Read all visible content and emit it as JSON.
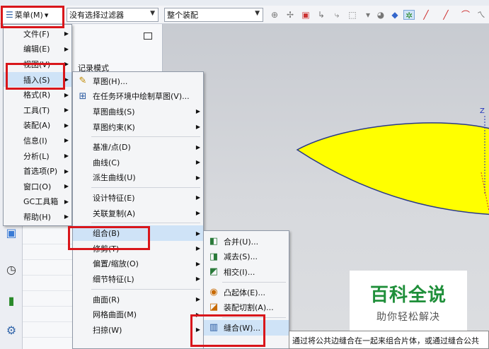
{
  "toolbar": {
    "menu_label": "菜单(M)",
    "menu_arrow": "▾",
    "filter_value": "没有选择过滤器",
    "assembly_value": "整个装配",
    "combo_arrow": "▼"
  },
  "main_menu": {
    "items": [
      {
        "label": "文件(F)"
      },
      {
        "label": "编辑(E)"
      },
      {
        "label": "视图(V)"
      },
      {
        "label": "插入(S)"
      },
      {
        "label": "格式(R)"
      },
      {
        "label": "工具(T)"
      },
      {
        "label": "装配(A)"
      },
      {
        "label": "信息(I)"
      },
      {
        "label": "分析(L)"
      },
      {
        "label": "首选项(P)"
      },
      {
        "label": "窗口(O)"
      },
      {
        "label": "GC工具箱"
      },
      {
        "label": "帮助(H)"
      }
    ]
  },
  "navigator": {
    "partial_label": "记录模式"
  },
  "insert_menu": {
    "items": [
      {
        "label": "草图(H)..."
      },
      {
        "label": "在任务环境中绘制草图(V)..."
      },
      {
        "label": "草图曲线(S)"
      },
      {
        "label": "草图约束(K)"
      },
      {
        "label": "基准/点(D)"
      },
      {
        "label": "曲线(C)"
      },
      {
        "label": "派生曲线(U)"
      },
      {
        "label": "设计特征(E)"
      },
      {
        "label": "关联复制(A)"
      },
      {
        "label": "组合(B)"
      },
      {
        "label": "修剪(T)"
      },
      {
        "label": "偏置/缩放(O)"
      },
      {
        "label": "细节特征(L)"
      },
      {
        "label": "曲面(R)"
      },
      {
        "label": "网格曲面(M)"
      },
      {
        "label": "扫掠(W)"
      }
    ]
  },
  "combine_menu": {
    "items": [
      {
        "label": "合并(U)..."
      },
      {
        "label": "减去(S)..."
      },
      {
        "label": "相交(I)..."
      },
      {
        "label": "凸起体(E)..."
      },
      {
        "label": "装配切割(A)..."
      },
      {
        "label": "缝合(W)..."
      }
    ]
  },
  "tooltip": {
    "text": "通过将公共边缝合在一起来组合片体，或通过缝合公共"
  },
  "watermark": {
    "title": "百科全说",
    "subtitle": "助你轻松解决"
  },
  "viewport": {
    "axis_label": "Z"
  },
  "colors": {
    "highlight": "#d9161b",
    "surface": "#ffff00",
    "watermark_green": "#1f8f3a"
  }
}
